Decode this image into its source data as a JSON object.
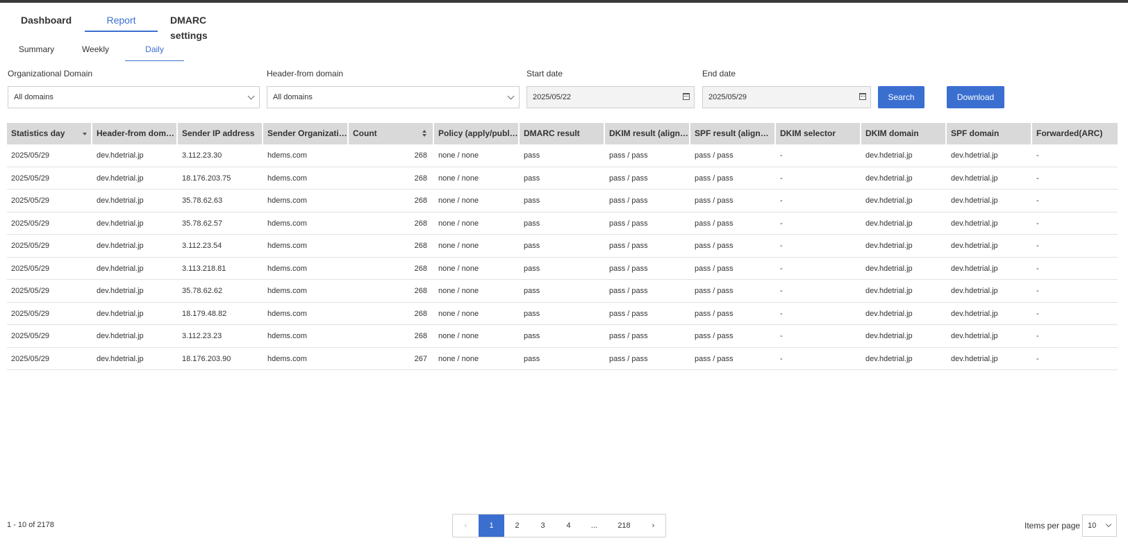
{
  "main_tabs": [
    "Dashboard",
    "Report",
    "DMARC settings"
  ],
  "sub_tabs": [
    "Summary",
    "Weekly",
    "Daily"
  ],
  "filters": {
    "org_domain_label": "Organizational Domain",
    "org_domain_value": "All domains",
    "header_from_label": "Header-from domain",
    "header_from_value": "All domains",
    "start_date_label": "Start date",
    "start_date_value": "2025/05/22",
    "end_date_label": "End date",
    "end_date_value": "2025/05/29",
    "search_label": "Search",
    "download_label": "Download"
  },
  "table": {
    "columns": [
      "Statistics day",
      "Header-from dom…",
      "Sender IP address",
      "Sender Organizati…",
      "Count",
      "Policy (apply/publ…",
      "DMARC result",
      "DKIM result (align…",
      "SPF result (alignm…",
      "DKIM selector",
      "DKIM domain",
      "SPF domain",
      "Forwarded(ARC)"
    ],
    "rows": [
      [
        "2025/05/29",
        "dev.hdetrial.jp",
        "3.112.23.30",
        "hdems.com",
        "268",
        "none / none",
        "pass",
        "pass / pass",
        "pass / pass",
        "-",
        "dev.hdetrial.jp",
        "dev.hdetrial.jp",
        "-"
      ],
      [
        "2025/05/29",
        "dev.hdetrial.jp",
        "18.176.203.75",
        "hdems.com",
        "268",
        "none / none",
        "pass",
        "pass / pass",
        "pass / pass",
        "-",
        "dev.hdetrial.jp",
        "dev.hdetrial.jp",
        "-"
      ],
      [
        "2025/05/29",
        "dev.hdetrial.jp",
        "35.78.62.63",
        "hdems.com",
        "268",
        "none / none",
        "pass",
        "pass / pass",
        "pass / pass",
        "-",
        "dev.hdetrial.jp",
        "dev.hdetrial.jp",
        "-"
      ],
      [
        "2025/05/29",
        "dev.hdetrial.jp",
        "35.78.62.57",
        "hdems.com",
        "268",
        "none / none",
        "pass",
        "pass / pass",
        "pass / pass",
        "-",
        "dev.hdetrial.jp",
        "dev.hdetrial.jp",
        "-"
      ],
      [
        "2025/05/29",
        "dev.hdetrial.jp",
        "3.112.23.54",
        "hdems.com",
        "268",
        "none / none",
        "pass",
        "pass / pass",
        "pass / pass",
        "-",
        "dev.hdetrial.jp",
        "dev.hdetrial.jp",
        "-"
      ],
      [
        "2025/05/29",
        "dev.hdetrial.jp",
        "3.113.218.81",
        "hdems.com",
        "268",
        "none / none",
        "pass",
        "pass / pass",
        "pass / pass",
        "-",
        "dev.hdetrial.jp",
        "dev.hdetrial.jp",
        "-"
      ],
      [
        "2025/05/29",
        "dev.hdetrial.jp",
        "35.78.62.62",
        "hdems.com",
        "268",
        "none / none",
        "pass",
        "pass / pass",
        "pass / pass",
        "-",
        "dev.hdetrial.jp",
        "dev.hdetrial.jp",
        "-"
      ],
      [
        "2025/05/29",
        "dev.hdetrial.jp",
        "18.179.48.82",
        "hdems.com",
        "268",
        "none / none",
        "pass",
        "pass / pass",
        "pass / pass",
        "-",
        "dev.hdetrial.jp",
        "dev.hdetrial.jp",
        "-"
      ],
      [
        "2025/05/29",
        "dev.hdetrial.jp",
        "3.112.23.23",
        "hdems.com",
        "268",
        "none / none",
        "pass",
        "pass / pass",
        "pass / pass",
        "-",
        "dev.hdetrial.jp",
        "dev.hdetrial.jp",
        "-"
      ],
      [
        "2025/05/29",
        "dev.hdetrial.jp",
        "18.176.203.90",
        "hdems.com",
        "267",
        "none / none",
        "pass",
        "pass / pass",
        "pass / pass",
        "-",
        "dev.hdetrial.jp",
        "dev.hdetrial.jp",
        "-"
      ]
    ]
  },
  "footer": {
    "range_text": "1 - 10 of 2178",
    "pages": [
      "1",
      "2",
      "3",
      "4",
      "...",
      "218"
    ],
    "items_per_page_label": "Items per page",
    "items_per_page_value": "10"
  }
}
